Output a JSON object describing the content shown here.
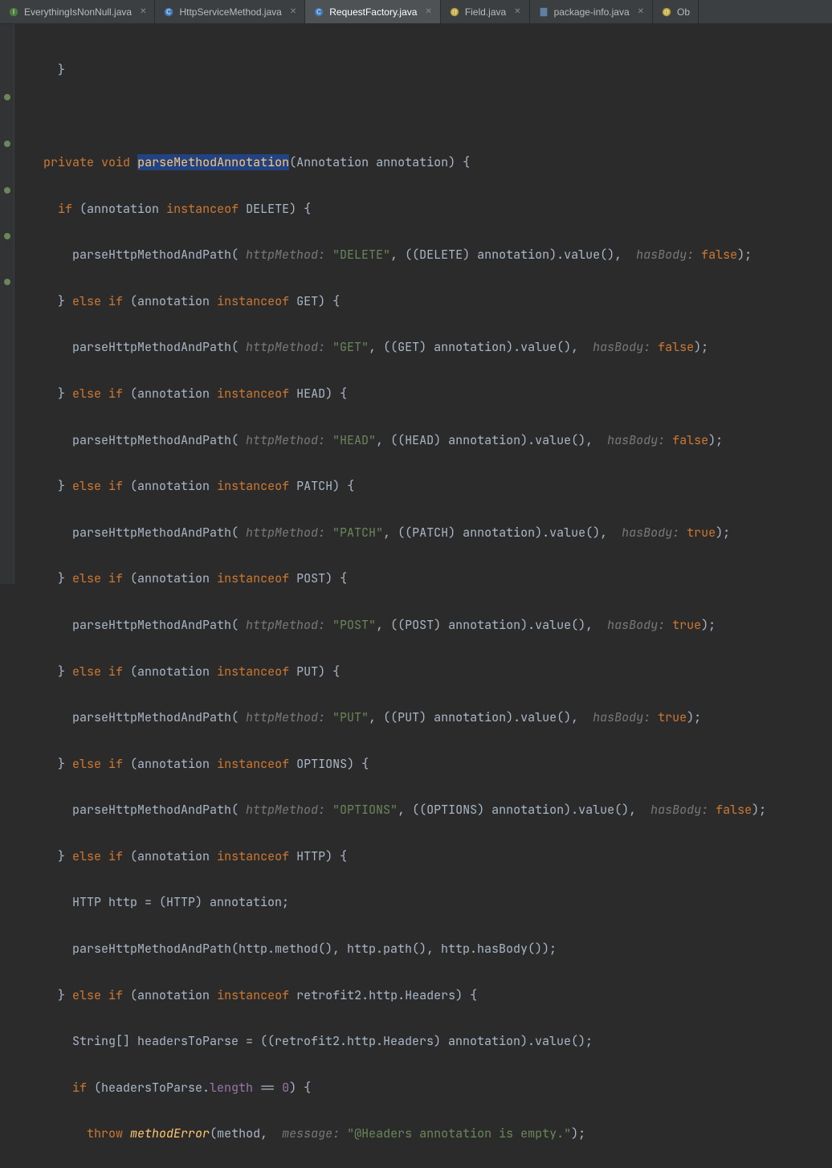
{
  "tabs": [
    {
      "label": "EverythingIsNonNull.java",
      "icon": "java-interface",
      "active": false
    },
    {
      "label": "HttpServiceMethod.java",
      "icon": "java-class",
      "active": false
    },
    {
      "label": "RequestFactory.java",
      "icon": "java-class",
      "active": true
    },
    {
      "label": "Field.java",
      "icon": "java-annotation",
      "active": false
    },
    {
      "label": "package-info.java",
      "icon": "java-file",
      "active": false
    },
    {
      "label": "Ob",
      "icon": "java-annotation",
      "active": false
    }
  ],
  "code": {
    "brace_close": "}",
    "l0": {
      "kw1": "private",
      "kw2": "void",
      "method": "parseMethodAnnotation",
      "sig": "(Annotation annotation) {"
    },
    "l1": {
      "kw1": "if",
      "expr1": "(annotation ",
      "kw2": "instanceof",
      "expr2": " DELETE) {"
    },
    "l2": {
      "call": "parseHttpMethodAndPath(",
      "hint1": " httpMethod: ",
      "str": "\"DELETE\"",
      "mid": ", ((DELETE) annotation).value(), ",
      "hint2": " hasBody: ",
      "lit": "false",
      "end": ");"
    },
    "l3": {
      "pre": "} ",
      "kw1": "else if",
      "expr1": " (annotation ",
      "kw2": "instanceof",
      "expr2": " GET) {"
    },
    "l4": {
      "call": "parseHttpMethodAndPath(",
      "hint1": " httpMethod: ",
      "str": "\"GET\"",
      "mid": ", ((GET) annotation).value(), ",
      "hint2": " hasBody: ",
      "lit": "false",
      "end": ");"
    },
    "l5": {
      "pre": "} ",
      "kw1": "else if",
      "expr1": " (annotation ",
      "kw2": "instanceof",
      "expr2": " HEAD) {"
    },
    "l6": {
      "call": "parseHttpMethodAndPath(",
      "hint1": " httpMethod: ",
      "str": "\"HEAD\"",
      "mid": ", ((HEAD) annotation).value(), ",
      "hint2": " hasBody: ",
      "lit": "false",
      "end": ");"
    },
    "l7": {
      "pre": "} ",
      "kw1": "else if",
      "expr1": " (annotation ",
      "kw2": "instanceof",
      "expr2": " PATCH) {"
    },
    "l8": {
      "call": "parseHttpMethodAndPath(",
      "hint1": " httpMethod: ",
      "str": "\"PATCH\"",
      "mid": ", ((PATCH) annotation).value(), ",
      "hint2": " hasBody: ",
      "lit": "true",
      "end": ");"
    },
    "l9": {
      "pre": "} ",
      "kw1": "else if",
      "expr1": " (annotation ",
      "kw2": "instanceof",
      "expr2": " POST) {"
    },
    "l10": {
      "call": "parseHttpMethodAndPath(",
      "hint1": " httpMethod: ",
      "str": "\"POST\"",
      "mid": ", ((POST) annotation).value(), ",
      "hint2": " hasBody: ",
      "lit": "true",
      "end": ");"
    },
    "l11": {
      "pre": "} ",
      "kw1": "else if",
      "expr1": " (annotation ",
      "kw2": "instanceof",
      "expr2": " PUT) {"
    },
    "l12": {
      "call": "parseHttpMethodAndPath(",
      "hint1": " httpMethod: ",
      "str": "\"PUT\"",
      "mid": ", ((PUT) annotation).value(), ",
      "hint2": " hasBody: ",
      "lit": "true",
      "end": ");"
    },
    "l13": {
      "pre": "} ",
      "kw1": "else if",
      "expr1": " (annotation ",
      "kw2": "instanceof",
      "expr2": " OPTIONS) {"
    },
    "l14": {
      "call": "parseHttpMethodAndPath(",
      "hint1": " httpMethod: ",
      "str": "\"OPTIONS\"",
      "mid": ", ((OPTIONS) annotation).value(), ",
      "hint2": " hasBody: ",
      "lit": "false",
      "end": ");"
    },
    "l15": {
      "pre": "} ",
      "kw1": "else if",
      "expr1": " (annotation ",
      "kw2": "instanceof",
      "expr2": " HTTP) {"
    },
    "l16": "HTTP http = (HTTP) annotation;",
    "l17": "parseHttpMethodAndPath(http.method(), http.path(), http.hasBody());",
    "l18": {
      "pre": "} ",
      "kw1": "else if",
      "expr1": " (annotation ",
      "kw2": "instanceof",
      "expr2": " retrofit2.http.Headers) {"
    },
    "l19": "String[] headersToParse = ((retrofit2.http.Headers) annotation).value();",
    "l20": {
      "kw1": "if",
      "expr1": " (headersToParse.",
      "field": "length",
      "expr2": " == ",
      "lit": "0",
      "end": ") {"
    },
    "l21": {
      "kw1": "throw",
      "sp": " ",
      "method": "methodError",
      "args1": "(method, ",
      "hint": " message: ",
      "str": "\"@Headers annotation is empty.\"",
      "end": ");"
    }
  }
}
